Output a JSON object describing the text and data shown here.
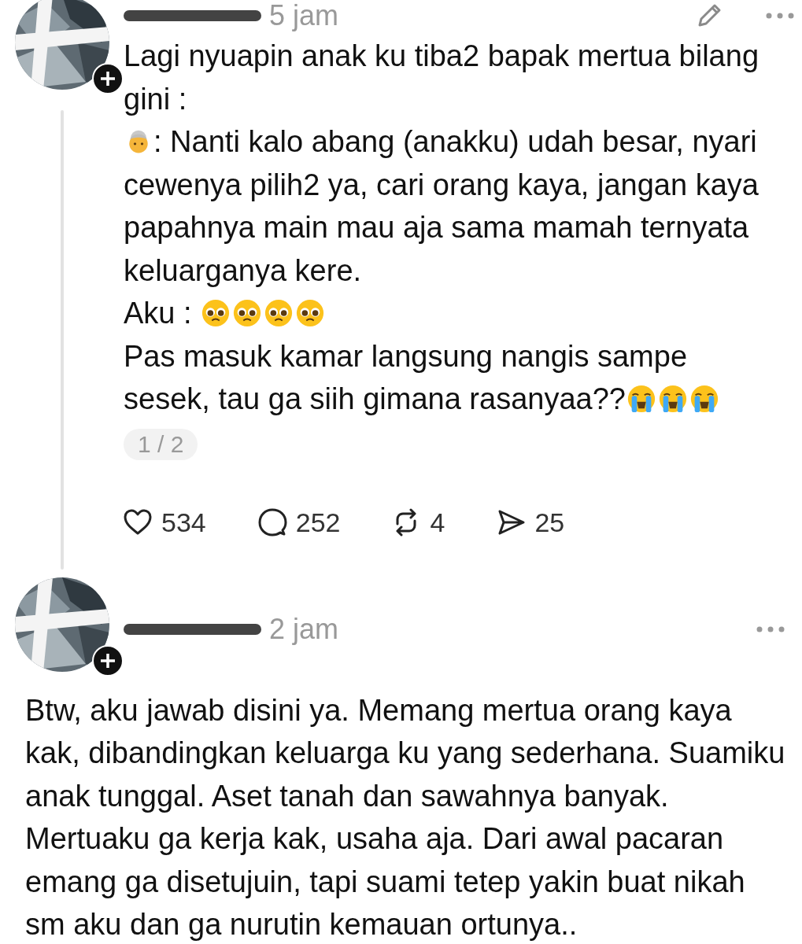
{
  "posts": [
    {
      "time": "5 jam",
      "avatar": {
        "kind": "picture"
      },
      "follow_badge": true,
      "editable": true,
      "thread_line": true,
      "paragraphs": [
        [
          {
            "kind": "text",
            "text": "Lagi nyuapin anak ku tiba2 bapak mertua bilang gini :"
          }
        ],
        [
          {
            "kind": "older-person"
          },
          {
            "kind": "text",
            "text": ": Nanti kalo abang (anakku) udah besar, nyari"
          }
        ],
        [
          {
            "kind": "text",
            "text": "cewenya pilih2 ya, cari orang kaya, jangan kaya papahnya main mau aja sama mamah ternyata keluarganya kere."
          }
        ],
        [
          {
            "kind": "text",
            "text": "Aku : "
          },
          {
            "kind": "pleading-face"
          },
          {
            "kind": "pleading-face"
          },
          {
            "kind": "pleading-face"
          },
          {
            "kind": "pleading-face"
          }
        ],
        [
          {
            "kind": "text",
            "text": "Pas masuk kamar langsung nangis sampe"
          }
        ],
        [
          {
            "kind": "text",
            "text": "sesek, tau ga siih gimana rasanyaa??"
          },
          {
            "kind": "crying-face"
          },
          {
            "kind": "crying-face"
          },
          {
            "kind": "crying-face"
          }
        ]
      ],
      "page_indicator": "1 / 2",
      "actions": [
        {
          "kind": "like",
          "count": "534"
        },
        {
          "kind": "comment",
          "count": "252"
        },
        {
          "kind": "repost",
          "count": "4"
        },
        {
          "kind": "share",
          "count": "25"
        }
      ]
    },
    {
      "time": "2 jam",
      "avatar": {
        "kind": "picture"
      },
      "follow_badge": true,
      "editable": false,
      "thread_line": false,
      "paragraphs": [
        [
          {
            "kind": "text",
            "text": "Btw, aku jawab disini ya. Memang mertua orang kaya kak, dibandingkan keluarga ku yang sederhana. Suamiku anak tunggal. Aset tanah dan sawahnya banyak. Mertuaku ga kerja kak, usaha aja. Dari awal pacaran emang ga disetujuin, tapi suami tetep yakin buat nikah sm aku dan ga nurutin kemauan ortunya.."
          }
        ]
      ]
    }
  ]
}
